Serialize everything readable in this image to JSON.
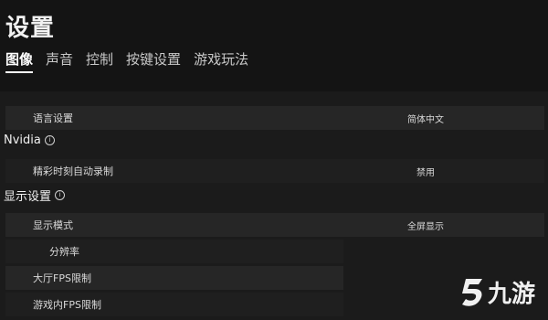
{
  "header": {
    "title": "设置",
    "tabs": [
      {
        "label": "图像",
        "active": true
      },
      {
        "label": "声音",
        "active": false
      },
      {
        "label": "控制",
        "active": false
      },
      {
        "label": "按键设置",
        "active": false
      },
      {
        "label": "游戏玩法",
        "active": false
      }
    ]
  },
  "settings": {
    "language": {
      "label": "语言设置",
      "value": "简体中文"
    },
    "nvidia_section": {
      "title": "Nvidia"
    },
    "highlights": {
      "label": "精彩时刻自动录制",
      "value": "禁用"
    },
    "display_section": {
      "title": "显示设置"
    },
    "display_mode": {
      "label": "显示模式",
      "value": "全屏显示"
    },
    "resolution": {
      "label": "分辨率"
    },
    "lobby_fps": {
      "label": "大厅FPS限制"
    },
    "ingame_fps": {
      "label": "游戏内FPS限制"
    }
  },
  "watermark": {
    "text": "九游"
  }
}
